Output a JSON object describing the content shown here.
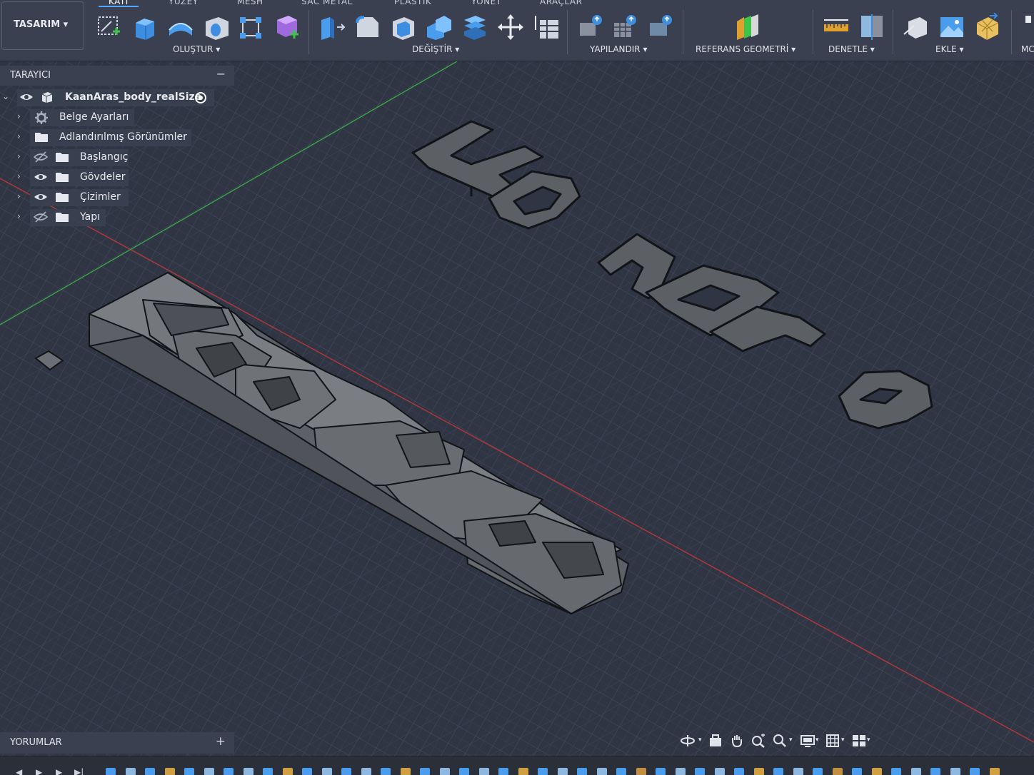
{
  "tabs": [
    {
      "label": "KATI",
      "active": true
    },
    {
      "label": "YÜZEY",
      "active": false
    },
    {
      "label": "MESH",
      "active": false
    },
    {
      "label": "SAC METAL",
      "active": false
    },
    {
      "label": "PLASTİK",
      "active": false
    },
    {
      "label": "YÖNET",
      "active": false
    },
    {
      "label": "ARAÇLAR",
      "active": false
    }
  ],
  "workspace": {
    "label": "TASARIM ▾"
  },
  "tool_groups": [
    {
      "label": "OLUŞTUR ▾"
    },
    {
      "label": "DEĞİŞTİR ▾"
    },
    {
      "label": "YAPILANDIR ▾"
    },
    {
      "label": "REFERANS GEOMETRİ ▾"
    },
    {
      "label": "DENETLE ▾"
    },
    {
      "label": "EKLE ▾"
    },
    {
      "label": "MC"
    }
  ],
  "browser": {
    "title": "TARAYICI",
    "collapse_icon": "minus-icon",
    "root": {
      "label": "KaanAras_body_realSize",
      "icons": [
        "eye-icon",
        "component-icon",
        "radio-icon"
      ]
    },
    "items": [
      {
        "label": "Belge Ayarları",
        "icon": "gear-icon",
        "visibility": "none"
      },
      {
        "label": "Adlandırılmış Görünümler",
        "icon": "folder-icon",
        "visibility": "none"
      },
      {
        "label": "Başlangıç",
        "icon": "folder-icon",
        "visibility": "hidden"
      },
      {
        "label": "Gövdeler",
        "icon": "folder-icon",
        "visibility": "visible"
      },
      {
        "label": "Çizimler",
        "icon": "folder-icon",
        "visibility": "visible"
      },
      {
        "label": "Yapı",
        "icon": "folder-icon",
        "visibility": "hidden"
      }
    ]
  },
  "comments": {
    "title": "YORUMLAR",
    "add_icon": "plus-icon"
  },
  "navbar_icons": [
    "orbit-icon",
    "look-at-icon",
    "pan-icon",
    "zoom-window-icon",
    "zoom-icon",
    "display-settings-icon",
    "grid-icon",
    "viewports-icon"
  ],
  "colors": {
    "accent": "#4fa8ff",
    "grid_bg": "#2f3543",
    "toolbar_bg": "#3a4050",
    "model_gray": "#6b6e73",
    "x_axis": "#b5383a",
    "y_axis": "#3aa548"
  }
}
